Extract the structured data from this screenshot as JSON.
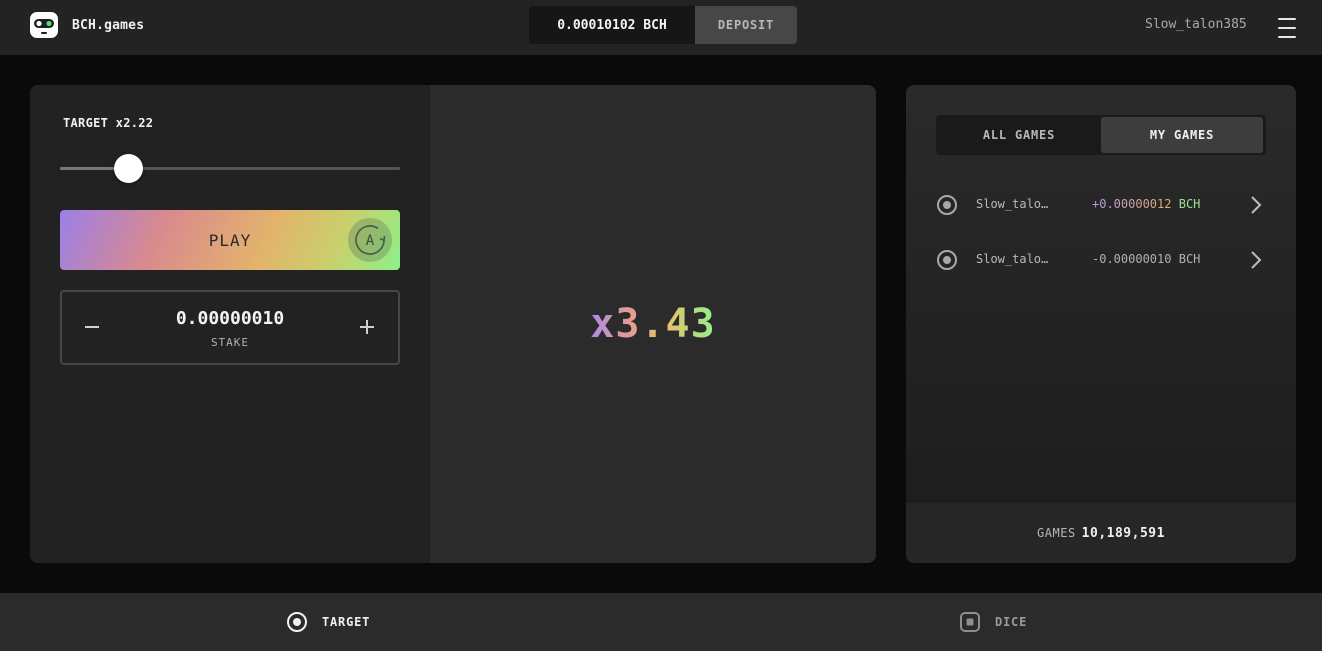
{
  "header": {
    "brand": "BCH.games",
    "balance": "0.00010102 BCH",
    "deposit_label": "DEPOSIT",
    "username": "Slow_talon385"
  },
  "game": {
    "target_label": "TARGET x2.22",
    "slider_fraction": 0.2,
    "play_label": "PLAY",
    "auto_label": "A",
    "stake_value": "0.00000010",
    "stake_label": "STAKE",
    "result": "x3.43"
  },
  "history": {
    "tabs": [
      {
        "label": "ALL GAMES",
        "active": false
      },
      {
        "label": "MY GAMES",
        "active": true
      }
    ],
    "rows": [
      {
        "user": "Slow_talo…",
        "sign": "+",
        "amount": "0.00000012",
        "currency": "BCH",
        "outcome": "win"
      },
      {
        "user": "Slow_talo…",
        "sign": "-",
        "amount": "0.00000010",
        "currency": "BCH",
        "outcome": "loss"
      }
    ],
    "games_label": "GAMES",
    "games_count": "10,189,591"
  },
  "nav": {
    "items": [
      {
        "label": "TARGET",
        "icon": "target-icon",
        "active": true
      },
      {
        "label": "DICE",
        "icon": "dice-icon",
        "active": false
      }
    ]
  },
  "colors": {
    "accent_gradient": [
      "#9b7fe8",
      "#d98a8d",
      "#e3b36c",
      "#8ef08a"
    ],
    "panel": "#2b2b2b",
    "header": "#232323"
  }
}
